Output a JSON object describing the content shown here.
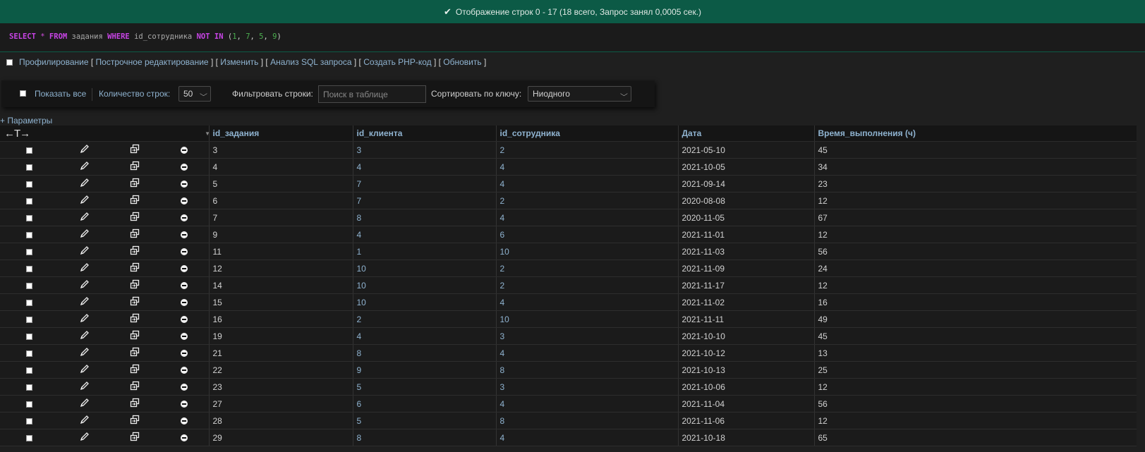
{
  "message": {
    "icon": "check-icon",
    "text": "Отображение строк 0 - 17 (18 всего, Запрос занял 0,0005 сек.)"
  },
  "sql": {
    "select": "SELECT",
    "star": "*",
    "from": "FROM",
    "table": "задания",
    "where": "WHERE",
    "column": "id_сотрудника",
    "not": "NOT",
    "in": "IN",
    "open_paren": "(",
    "values": [
      "1",
      "7",
      "5",
      "9"
    ],
    "close_paren": ")"
  },
  "query_links": {
    "profiling": "Профилирование",
    "inline_edit": "Построчное редактирование",
    "edit": "Изменить",
    "explain": "Анализ SQL запроса",
    "php_code": "Создать PHP-код",
    "refresh": "Обновить"
  },
  "toolbar": {
    "show_all": "Показать все",
    "rows_label": "Количество строк:",
    "rows_value": "50",
    "filter_label": "Фильтровать строки:",
    "filter_placeholder": "Поиск в таблице",
    "sort_label": "Сортировать по ключу:",
    "sort_value": "Ниодного"
  },
  "options_link": "+ Параметры",
  "table": {
    "column_toggle": "←T→",
    "columns": [
      "id_задания",
      "id_клиента",
      "id_сотрудника",
      "Дата",
      "Время_выполнения (ч)"
    ],
    "rows": [
      [
        "3",
        "3",
        "2",
        "2021-05-10",
        "45"
      ],
      [
        "4",
        "4",
        "4",
        "2021-10-05",
        "34"
      ],
      [
        "5",
        "7",
        "4",
        "2021-09-14",
        "23"
      ],
      [
        "6",
        "7",
        "2",
        "2020-08-08",
        "12"
      ],
      [
        "7",
        "8",
        "4",
        "2020-11-05",
        "67"
      ],
      [
        "9",
        "4",
        "6",
        "2021-11-01",
        "12"
      ],
      [
        "11",
        "1",
        "10",
        "2021-11-03",
        "56"
      ],
      [
        "12",
        "10",
        "2",
        "2021-11-09",
        "24"
      ],
      [
        "14",
        "10",
        "2",
        "2021-11-17",
        "12"
      ],
      [
        "15",
        "10",
        "4",
        "2021-11-02",
        "16"
      ],
      [
        "16",
        "2",
        "10",
        "2021-11-11",
        "49"
      ],
      [
        "19",
        "4",
        "3",
        "2021-10-10",
        "45"
      ],
      [
        "21",
        "8",
        "4",
        "2021-10-12",
        "13"
      ],
      [
        "22",
        "9",
        "8",
        "2021-10-13",
        "25"
      ],
      [
        "23",
        "5",
        "3",
        "2021-10-06",
        "12"
      ],
      [
        "27",
        "6",
        "4",
        "2021-11-04",
        "56"
      ],
      [
        "28",
        "5",
        "8",
        "2021-11-06",
        "12"
      ],
      [
        "29",
        "8",
        "4",
        "2021-10-18",
        "65"
      ]
    ]
  }
}
